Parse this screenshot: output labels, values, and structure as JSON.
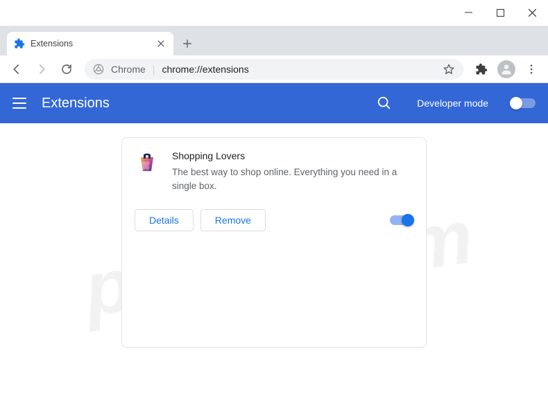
{
  "window": {
    "tab_title": "Extensions",
    "omnibox_label": "Chrome",
    "omnibox_url": "chrome://extensions"
  },
  "header": {
    "title": "Extensions",
    "dev_mode_label": "Developer mode",
    "dev_mode_on": false
  },
  "extension": {
    "name": "Shopping Lovers",
    "description": "The best way to shop online. Everything you need in a single box.",
    "enabled": true,
    "details_label": "Details",
    "remove_label": "Remove"
  },
  "watermark": "pcrisk.com"
}
